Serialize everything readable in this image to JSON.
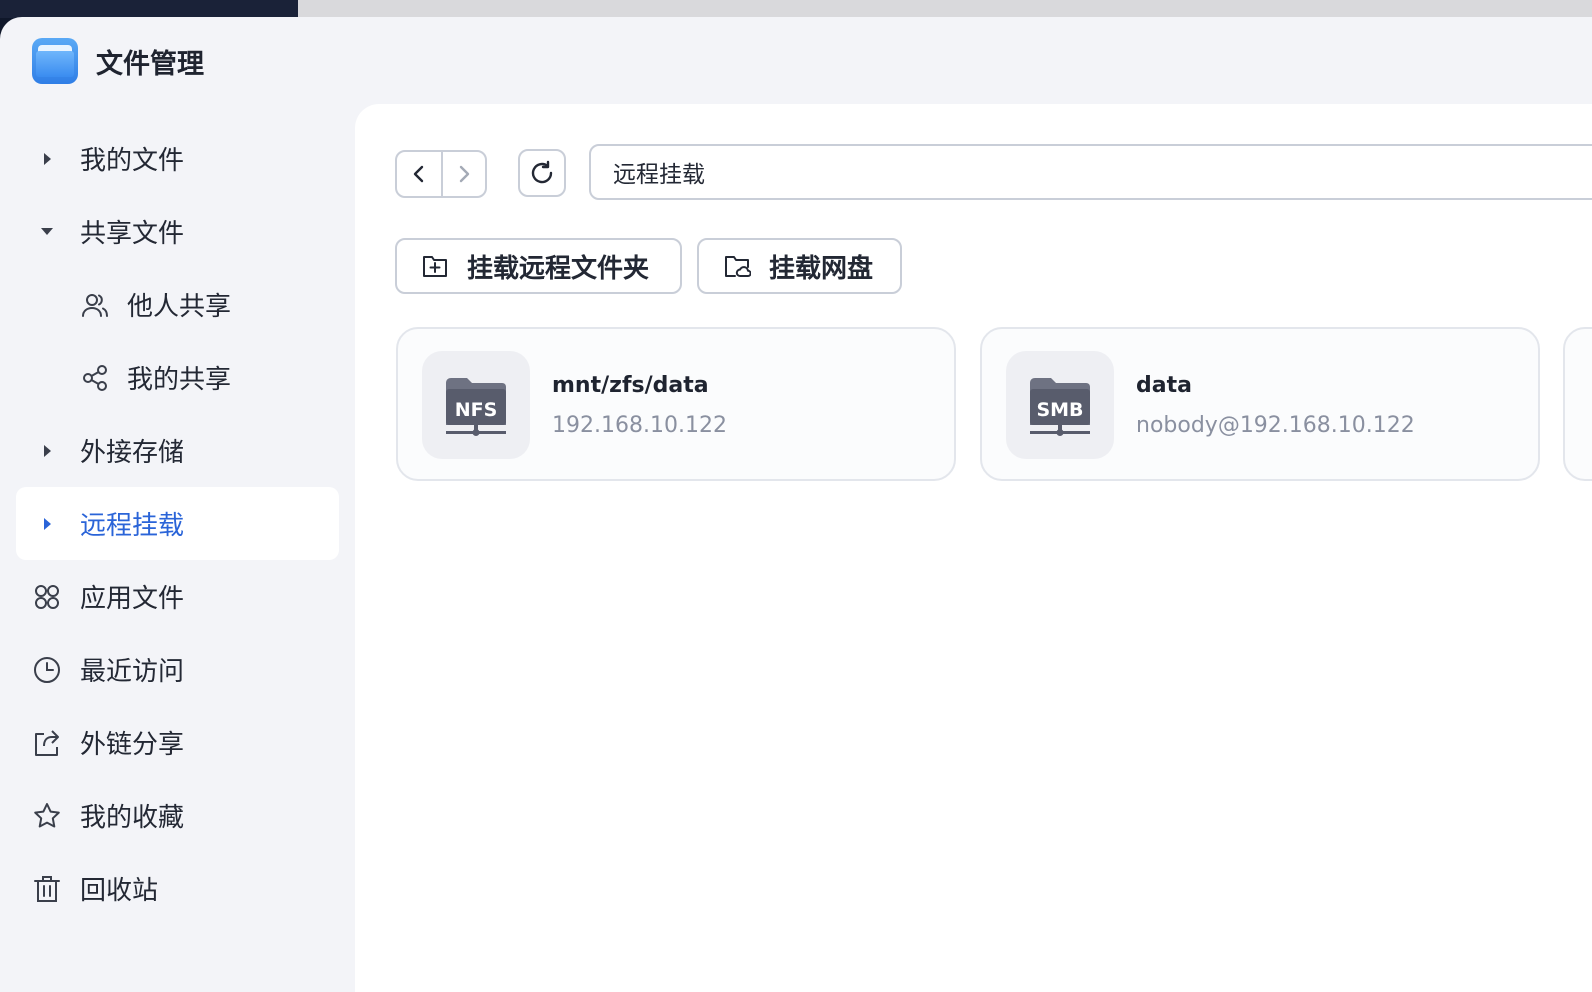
{
  "app": {
    "title": "文件管理"
  },
  "sidebar": {
    "items": [
      {
        "label": "我的文件",
        "caret": "right",
        "active": false
      },
      {
        "label": "共享文件",
        "caret": "down",
        "active": false
      },
      {
        "label": "他人共享",
        "icon": "users-icon",
        "sub": true
      },
      {
        "label": "我的共享",
        "icon": "share-icon",
        "sub": true
      },
      {
        "label": "外接存储",
        "caret": "right",
        "active": false
      },
      {
        "label": "远程挂载",
        "caret": "right",
        "active": true
      },
      {
        "label": "应用文件",
        "icon": "apps-icon"
      },
      {
        "label": "最近访问",
        "icon": "clock-icon"
      },
      {
        "label": "外链分享",
        "icon": "external-link-icon"
      },
      {
        "label": "我的收藏",
        "icon": "star-icon"
      },
      {
        "label": "回收站",
        "icon": "trash-icon"
      }
    ]
  },
  "toolbar": {
    "path": "远程挂载",
    "mount_remote_folder": "挂载远程文件夹",
    "mount_cloud_drive": "挂载网盘"
  },
  "mounts": [
    {
      "type": "NFS",
      "title": "mnt/zfs/data",
      "subtitle": "192.168.10.122"
    },
    {
      "type": "SMB",
      "title": "data",
      "subtitle": "nobody@192.168.10.122"
    }
  ],
  "colors": {
    "accent": "#2a64d8",
    "active_bg": "#ffffff",
    "sidebar_bg": "#f3f4f8",
    "border": "#c9ced8",
    "muted_text": "#8a90a0"
  }
}
